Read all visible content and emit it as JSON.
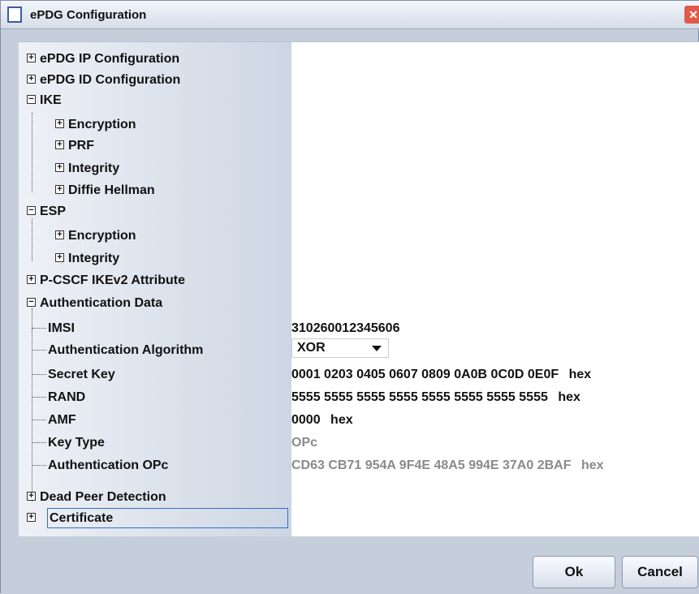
{
  "window": {
    "title": "ePDG Configuration",
    "close_icon": "close-icon"
  },
  "tree": {
    "items": [
      {
        "label": "ePDG IP Configuration"
      },
      {
        "label": "ePDG ID Configuration"
      },
      {
        "label": "IKE"
      },
      {
        "label": "Encryption"
      },
      {
        "label": "PRF"
      },
      {
        "label": "Integrity"
      },
      {
        "label": "Diffie Hellman"
      },
      {
        "label": "ESP"
      },
      {
        "label": "Encryption"
      },
      {
        "label": "Integrity"
      },
      {
        "label": "P-CSCF IKEv2 Attribute"
      },
      {
        "label": "Authentication Data"
      },
      {
        "label": "IMSI"
      },
      {
        "label": "Authentication Algorithm"
      },
      {
        "label": "Secret Key"
      },
      {
        "label": "RAND"
      },
      {
        "label": "AMF"
      },
      {
        "label": "Key Type"
      },
      {
        "label": "Authentication OPc"
      },
      {
        "label": "Dead Peer Detection"
      },
      {
        "label": "Certificate"
      }
    ],
    "toggles": {
      "expand": "⊞",
      "collapse": "⊟"
    }
  },
  "values": {
    "imsi": "310260012345606",
    "auth_algorithm": "XOR",
    "secret_key": "0001 0203 0405 0607 0809 0A0B 0C0D 0E0F",
    "secret_key_unit": "hex",
    "rand": "5555 5555 5555 5555 5555 5555 5555 5555",
    "rand_unit": "hex",
    "amf": "0000",
    "amf_unit": "hex",
    "key_type": "OPc",
    "auth_opc": "CD63 CB71 954A 9F4E 48A5 994E 37A0 2BAF",
    "auth_opc_unit": "hex"
  },
  "buttons": {
    "ok": "Ok",
    "cancel": "Cancel"
  }
}
